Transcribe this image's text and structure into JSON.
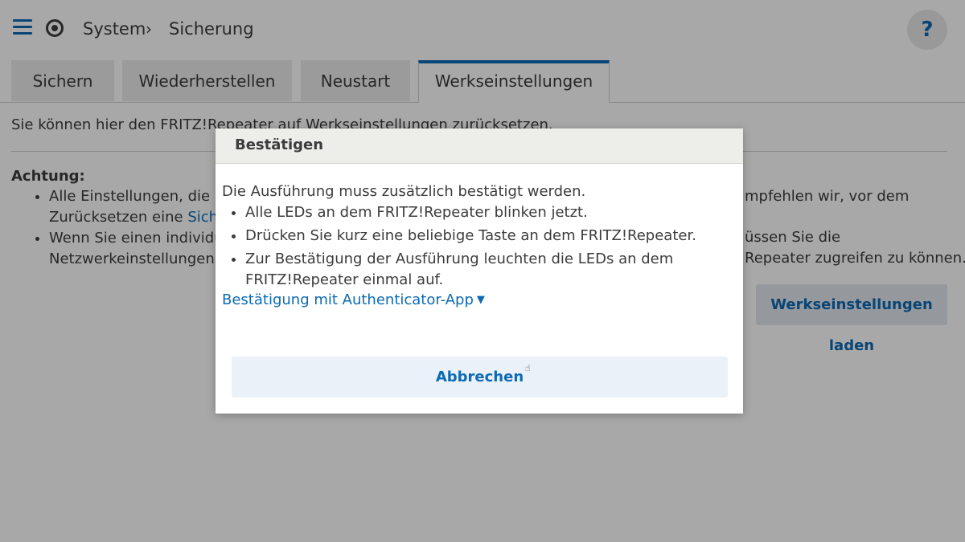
{
  "header": {
    "breadcrumb": [
      "System",
      "Sicherung"
    ],
    "help_label": "?"
  },
  "tabs": [
    {
      "label": "Sichern",
      "active": false
    },
    {
      "label": "Wiederherstellen",
      "active": false
    },
    {
      "label": "Neustart",
      "active": false
    },
    {
      "label": "Werkseinstellungen",
      "active": true
    }
  ],
  "page": {
    "intro": "Sie können hier den FRITZ!Repeater auf Werkseinstellungen zurücksetzen.",
    "warning_heading": "Achtung:",
    "bullet1_a": "Alle Einstellungen, die Sie",
    "bullet1_b": "Zurücksetzen eine",
    "bullet1_link": "Sicheru",
    "bullet2_a": "Wenn Sie einen individuel",
    "bullet2_b": "Netzwerkeinstellungen Ih",
    "bullet1_right": "mpfehlen wir, vor dem",
    "bullet2_right_a": "üssen Sie die",
    "bullet2_right_b": "Repeater zugreifen zu können.",
    "load_button": "Werkseinstellungen laden"
  },
  "dialog": {
    "title": "Bestätigen",
    "message": "Die Ausführung muss zusätzlich bestätigt werden.",
    "steps": [
      "Alle LEDs an dem FRITZ!Repeater blinken jetzt.",
      "Drücken Sie kurz eine beliebige Taste an dem FRITZ!Repeater.",
      "Zur Bestätigung der Ausführung leuchten die LEDs an dem FRITZ!Repeater einmal auf."
    ],
    "auth_link": "Bestätigung mit Authenticator-App",
    "cancel_button": "Abbrechen"
  },
  "colors": {
    "accent": "#0d6ab3",
    "tab_inactive_bg": "#ececec",
    "dialog_header_bg": "#ededea",
    "button_bg": "#eaf1f8"
  },
  "icons": {
    "menu": "menu-icon",
    "logo": "fritz-logo-icon",
    "breadcrumb_separator": "chevron-right-icon",
    "auth_caret": "caret-down-icon"
  }
}
